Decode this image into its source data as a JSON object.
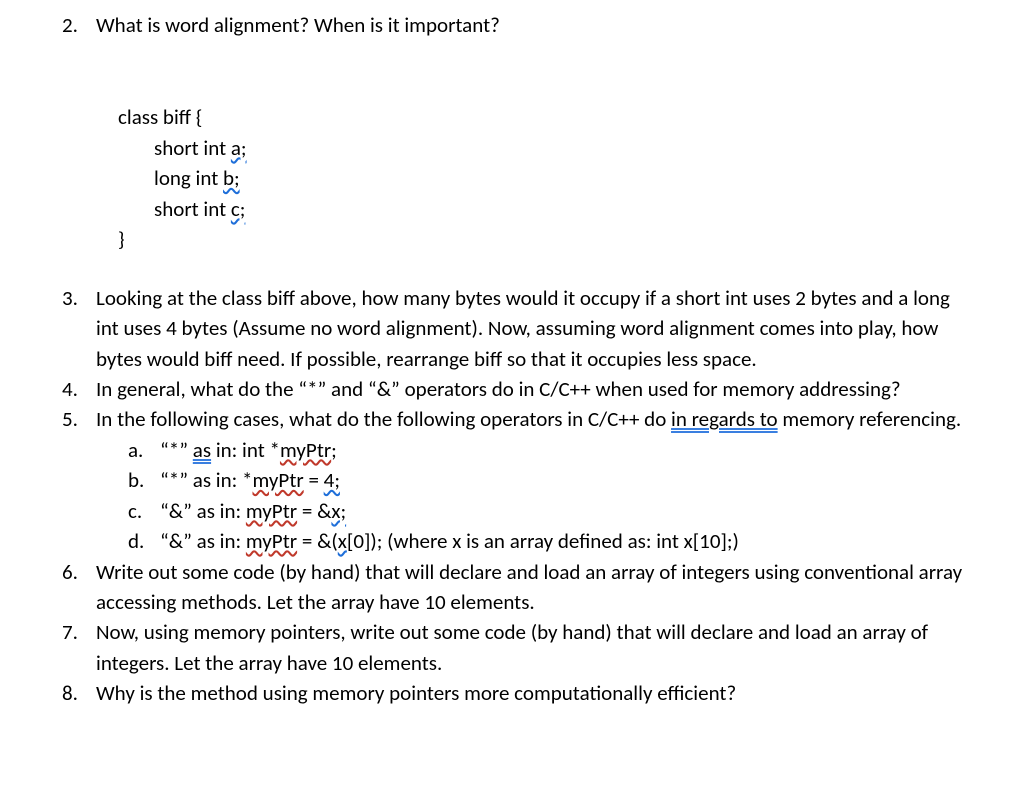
{
  "q2": {
    "num": "2.",
    "text": "What is word alignment?  When is it important?"
  },
  "code": {
    "l1": "class biff {",
    "l2a": "short int ",
    "l2b": "a;",
    "l3a": "long int ",
    "l3b": "b;",
    "l4a": "short int ",
    "l4b": "c;",
    "l5": "}"
  },
  "q3": {
    "num": "3.",
    "text": "Looking at the class biff above, how many bytes would it occupy if a short int uses 2 bytes and a long int uses 4 bytes (Assume no word alignment).  Now, assuming word alignment comes into play, how bytes would biff need.  If possible, rearrange biff so that it occupies less space."
  },
  "q4": {
    "num": "4.",
    "text": "In general, what do the “*” and “&” operators do in C/C++ when used for memory addressing?"
  },
  "q5": {
    "num": "5.",
    "text_a": "In the following cases, what do the following operators in C/C++ do ",
    "text_underlined": "in regards to",
    "text_b": " memory referencing.",
    "a": {
      "let": "a.",
      "p1": "“*” ",
      "p_as": " as",
      "p2": " in: int *",
      "p_myptr": "myPtr",
      "p3": ";"
    },
    "b": {
      "let": "b.",
      "p1": "“*” as in: *",
      "p_myptr": "myPtr",
      "p2": " = ",
      "p_4": "4;"
    },
    "c": {
      "let": "c.",
      "p1": "“&” as in: ",
      "p_myptr": "myPtr",
      "p2": " = &",
      "p_x": "x;"
    },
    "d": {
      "let": "d.",
      "p1": "“&” as in: ",
      "p_myptr": "myPtr",
      "p2": " = &(",
      "p_x": "x",
      "p3": "[0]);  (where x is an array defined as: int x[10];)"
    }
  },
  "q6": {
    "num": "6.",
    "text": "Write out some code (by hand) that will declare and load an array of integers using conventional array accessing methods.  Let the array have 10 elements."
  },
  "q7": {
    "num": "7.",
    "text": "Now, using memory pointers, write out some code (by hand) that will declare and load an array of integers.  Let the array have 10 elements."
  },
  "q8": {
    "num": "8.",
    "text": "Why is the method using memory pointers more computationally efficient?"
  }
}
